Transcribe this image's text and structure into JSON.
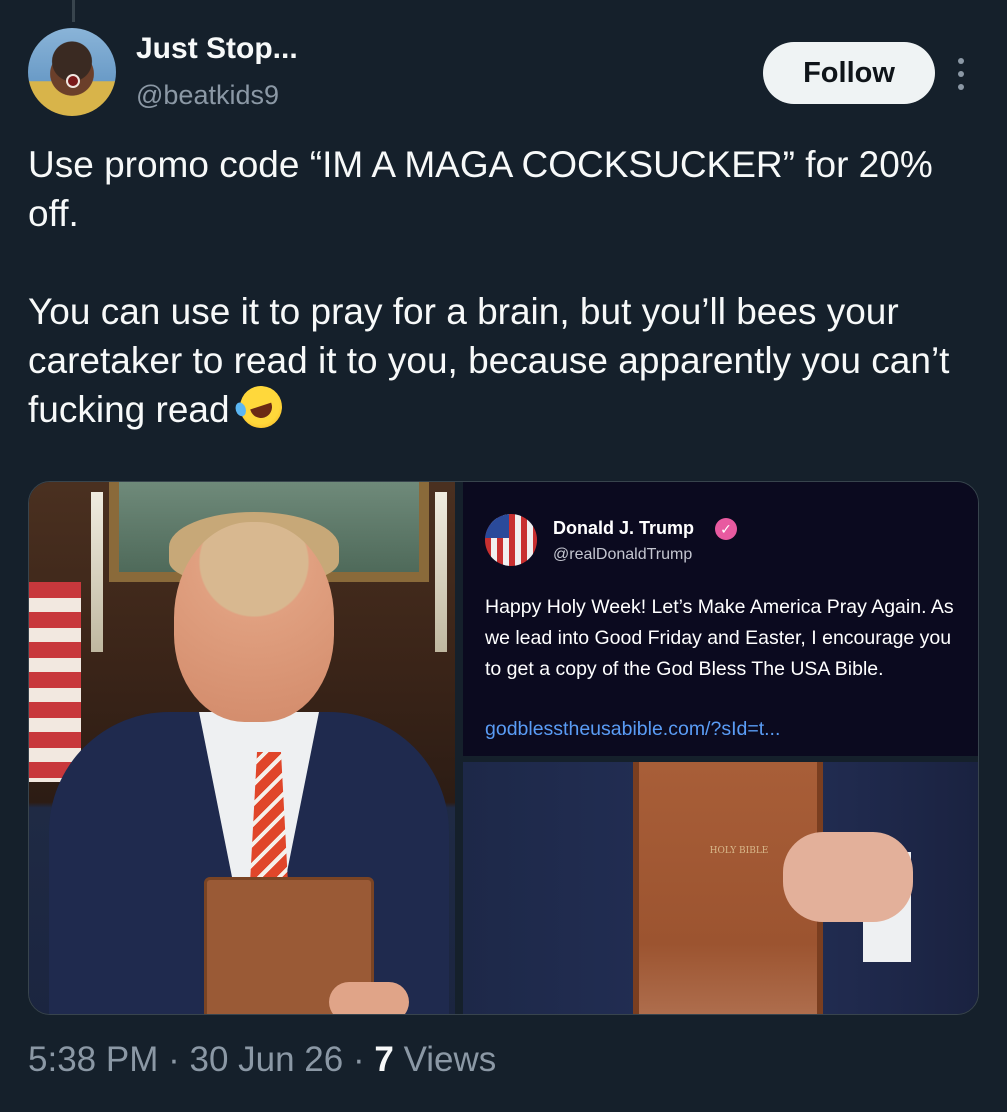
{
  "author": {
    "display_name": "Just Stop...",
    "handle": "@beatkids9",
    "follow_label": "Follow"
  },
  "tweet": {
    "text": "Use promo code “IM A MAGA COCKSUCKER” for 20% off.\n\nYou can use it to pray for a brain, but you’ll bees your caretaker to read it to you, because apparently you can’t fucking read",
    "emoji": "rolling-on-floor-laughing"
  },
  "embedded_post": {
    "display_name": "Donald J. Trump",
    "handle": "@realDonaldTrump",
    "text": "Happy Holy Week! Let’s Make America Pray Again. As we lead into Good Friday and Easter, I encourage you to get a copy of the God Bless The USA Bible.",
    "link": "godblesstheusabible.com/?sId=t..."
  },
  "media": {
    "bible_title": "HOLY BIBLE"
  },
  "meta": {
    "time": "5:38 PM",
    "date": "30 Jun 26",
    "views_count": "7",
    "views_label": "Views"
  },
  "colors": {
    "background": "#15202b",
    "text": "#f7f9f9",
    "secondary_text": "#8b98a5",
    "link": "#5a9cf5",
    "verified_badge": "#e85aa0"
  }
}
